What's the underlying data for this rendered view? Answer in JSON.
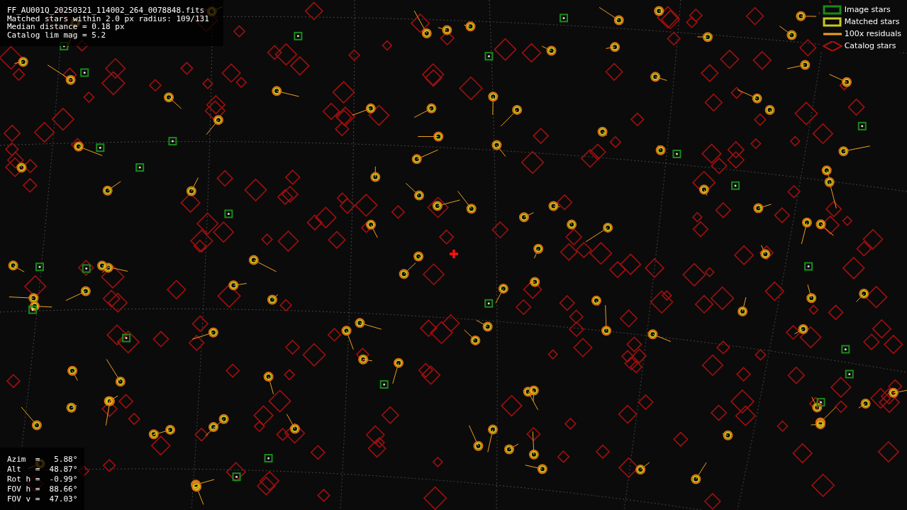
{
  "header": {
    "lines": [
      "FF_AU001Q_20250321_114002_264_0078848.fits",
      "Matched stars within 2.0 px radius: 109/131",
      "Median distance = 0.18 px",
      "Catalog lim mag = 5.2"
    ]
  },
  "legend": [
    {
      "kind": "box",
      "label": "Image stars",
      "color": "#1a8a1a"
    },
    {
      "kind": "box",
      "label": "Matched stars",
      "color": "#c8c81e"
    },
    {
      "kind": "line",
      "label": "100x residuals",
      "color": "#f0a020"
    },
    {
      "kind": "diamond",
      "label": "Catalog stars",
      "color": "#b01010"
    }
  ],
  "pointing": {
    "lines": [
      "Azim  =   5.88°",
      "Alt   =  48.87°",
      "Rot h =  -0.99°",
      "FOV h =  88.66°",
      "FOV v =  47.03°"
    ]
  }
}
